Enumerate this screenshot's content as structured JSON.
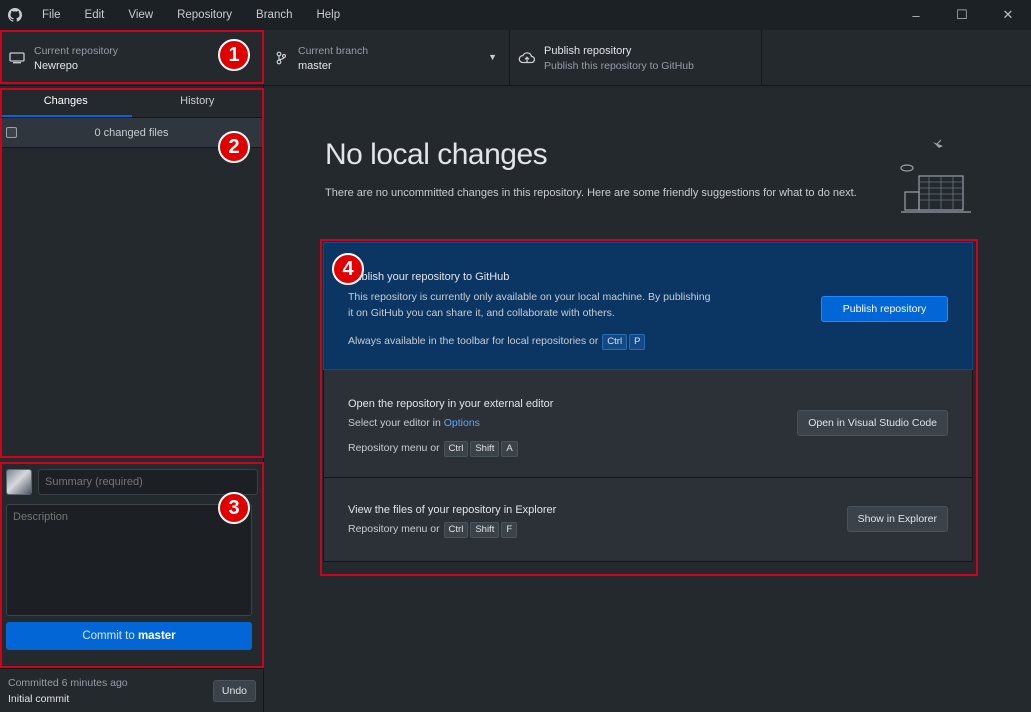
{
  "menu": [
    "File",
    "Edit",
    "View",
    "Repository",
    "Branch",
    "Help"
  ],
  "window_controls": {
    "minimize": "–",
    "maximize": "☐",
    "close": "✕"
  },
  "toolbar": {
    "repo": {
      "label": "Current repository",
      "value": "Newrepo"
    },
    "branch": {
      "label": "Current branch",
      "value": "master"
    },
    "publish": {
      "label": "Publish repository",
      "value": "Publish this repository to GitHub"
    }
  },
  "sidebar": {
    "tabs": [
      "Changes",
      "History"
    ],
    "active_tab": "Changes",
    "changed_files": "0 changed files",
    "summary_placeholder": "Summary (required)",
    "description_placeholder": "Description",
    "commit_button": {
      "prefix": "Commit to",
      "branch": "master"
    },
    "last_commit": {
      "time": "Committed 6 minutes ago",
      "message": "Initial commit",
      "undo": "Undo"
    }
  },
  "main": {
    "heading": "No local changes",
    "subtext": "There are no uncommitted changes in this repository. Here are some friendly suggestions for what to do next.",
    "cards": {
      "publish": {
        "title": "Publish your repository to GitHub",
        "line1": "This repository is currently only available on your local machine. By publishing",
        "line2": "it on GitHub you can share it, and collaborate with others.",
        "hint": "Always available in the toolbar for local repositories or",
        "keys": [
          "Ctrl",
          "P"
        ],
        "button": "Publish repository"
      },
      "editor": {
        "title": "Open the repository in your external editor",
        "select_prefix": "Select your editor in",
        "select_link": "Options",
        "menu_label": "Repository menu or",
        "keys": [
          "Ctrl",
          "Shift",
          "A"
        ],
        "button": "Open in Visual Studio Code"
      },
      "explorer": {
        "title": "View the files of your repository in Explorer",
        "menu_label": "Repository menu or",
        "keys": [
          "Ctrl",
          "Shift",
          "F"
        ],
        "button": "Show in Explorer"
      }
    }
  },
  "annotations": [
    "1",
    "2",
    "3",
    "4"
  ],
  "colors": {
    "highlight": "#d0021b",
    "accent": "#0366d6",
    "publish_card": "#0b3663"
  },
  "icons": [
    "github-logo-icon",
    "repo-icon",
    "branch-icon",
    "cloud-upload-icon",
    "caret-down-icon",
    "file-diff-icon"
  ]
}
